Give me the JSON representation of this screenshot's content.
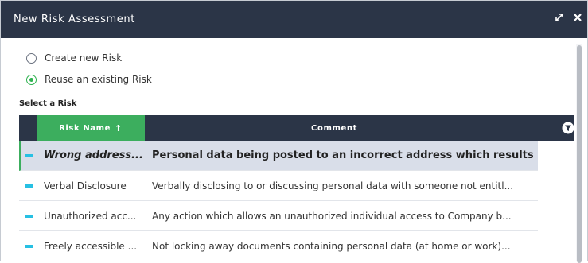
{
  "dialog": {
    "title": "New Risk Assessment",
    "expand_icon": "expand-icon",
    "close_icon": "close-icon"
  },
  "options": [
    {
      "label": "Create new Risk",
      "selected": false
    },
    {
      "label": "Reuse an existing Risk",
      "selected": true
    }
  ],
  "select_label": "Select a Risk",
  "grid": {
    "columns": [
      {
        "label": "Risk Name",
        "sort_indicator": "↑"
      },
      {
        "label": "Comment"
      }
    ],
    "filter_icon": "filter-icon",
    "rows": [
      {
        "name": "Wrong address...",
        "comment": "Personal data being posted to an incorrect address which results...",
        "selected": true
      },
      {
        "name": "Verbal Disclosure",
        "comment": "Verbally disclosing to or discussing personal data with someone not entitl...",
        "selected": false
      },
      {
        "name": "Unauthorized acc...",
        "comment": "Any action which allows an unauthorized individual access to Company b...",
        "selected": false
      },
      {
        "name": "Freely accessible ...",
        "comment": "Not locking away documents containing personal data (at home or work)...",
        "selected": false
      }
    ]
  },
  "colors": {
    "header_bg": "#2b3547",
    "accent_green": "#3cae5e",
    "row_marker": "#27c0e3",
    "selected_row_bg": "#d9dee9"
  }
}
